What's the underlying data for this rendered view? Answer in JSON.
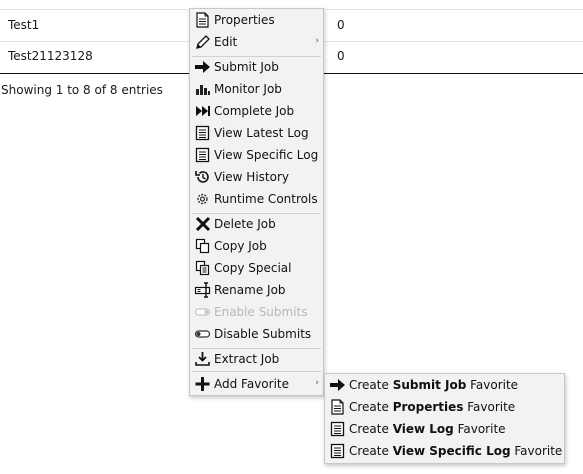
{
  "table": {
    "rows": [
      {
        "name": "Test1",
        "count": "0"
      },
      {
        "name": "Test21123128",
        "count": "0"
      }
    ],
    "info": "Showing 1 to 8 of 8 entries"
  },
  "context_menu": {
    "items": [
      {
        "label": "Properties",
        "icon": "document-icon"
      },
      {
        "label": "Edit",
        "icon": "pencil-icon",
        "submenu_arrow": "›"
      },
      {
        "label": "Submit Job",
        "icon": "right-arrow-icon"
      },
      {
        "label": "Monitor Job",
        "icon": "bar-chart-icon"
      },
      {
        "label": "Complete Job",
        "icon": "fast-forward-icon"
      },
      {
        "label": "View Latest Log",
        "icon": "log-icon"
      },
      {
        "label": "View Specific Log",
        "icon": "log-icon"
      },
      {
        "label": "View History",
        "icon": "history-icon"
      },
      {
        "label": "Runtime Controls",
        "icon": "gear-icon"
      },
      {
        "label": "Delete Job",
        "icon": "x-icon"
      },
      {
        "label": "Copy Job",
        "icon": "copy-icon"
      },
      {
        "label": "Copy Special",
        "icon": "copy-special-icon"
      },
      {
        "label": "Rename Job",
        "icon": "rename-icon"
      },
      {
        "label": "Enable Submits",
        "icon": "toggle-off-icon",
        "disabled": true
      },
      {
        "label": "Disable Submits",
        "icon": "toggle-icon"
      },
      {
        "label": "Extract Job",
        "icon": "download-icon"
      },
      {
        "label": "Add Favorite",
        "icon": "plus-icon",
        "submenu_arrow": "›"
      }
    ]
  },
  "favorite_submenu": {
    "items": [
      {
        "prefix": "Create ",
        "bold": "Submit Job",
        "suffix": " Favorite",
        "icon": "right-arrow-icon"
      },
      {
        "prefix": "Create ",
        "bold": "Properties",
        "suffix": " Favorite",
        "icon": "document-icon"
      },
      {
        "prefix": "Create ",
        "bold": "View Log",
        "suffix": " Favorite",
        "icon": "log-icon"
      },
      {
        "prefix": "Create ",
        "bold": "View Specific Log",
        "suffix": " Favorite",
        "icon": "log-icon"
      }
    ]
  }
}
